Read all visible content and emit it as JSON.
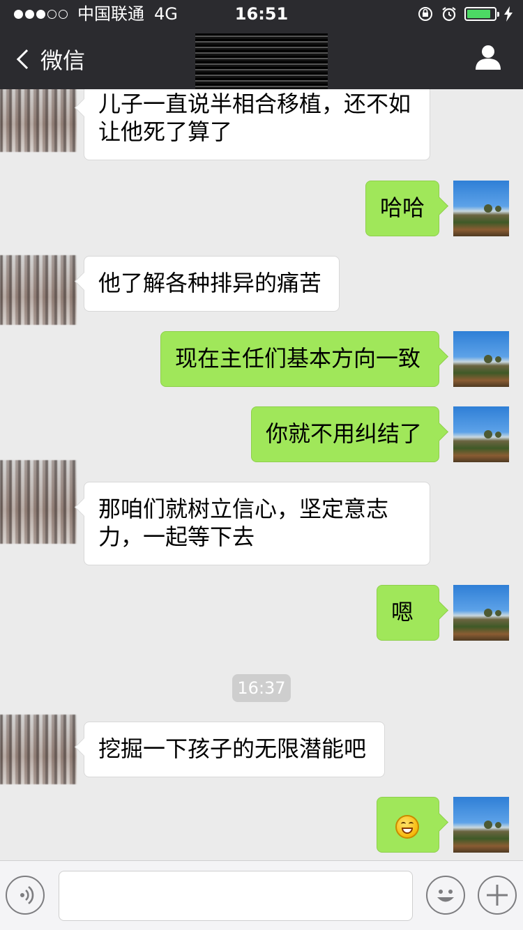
{
  "status_bar": {
    "carrier": "中国联通",
    "network": "4G",
    "time": "16:51",
    "battery_level": 0.88
  },
  "nav": {
    "back_label": "微信",
    "chat_title": ""
  },
  "messages": [
    {
      "side": "in",
      "text": "儿子一直说半相合移植，还不如让他死了算了"
    },
    {
      "side": "out",
      "text": "哈哈"
    },
    {
      "side": "in",
      "text": "他了解各种排异的痛苦"
    },
    {
      "side": "out",
      "text": "现在主任们基本方向一致"
    },
    {
      "side": "out",
      "text": "你就不用纠结了"
    },
    {
      "side": "in",
      "text": "那咱们就树立信心，坚定意志力，一起等下去"
    },
    {
      "side": "out",
      "text": "嗯"
    },
    {
      "side": "in",
      "text": "挖掘一下孩子的无限潜能吧"
    },
    {
      "side": "out",
      "text": "",
      "emoji": "grinning-face"
    }
  ],
  "timestamp_divider": "16:37",
  "input_bar": {
    "value": "",
    "icons": [
      "voice-icon",
      "emoji-icon",
      "plus-icon"
    ]
  },
  "colors": {
    "nav_bg": "#2b2b2f",
    "chat_bg": "#ebebeb",
    "outgoing_bubble": "#a0e75a",
    "incoming_bubble": "#ffffff"
  }
}
